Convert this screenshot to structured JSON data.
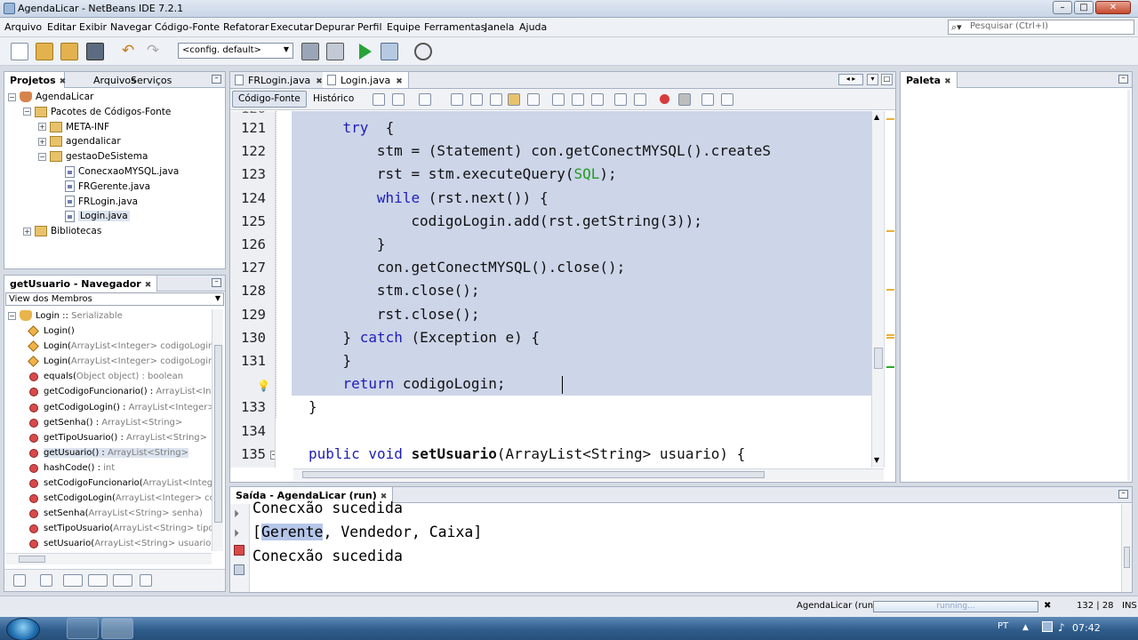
{
  "window": {
    "title": "AgendaLicar - NetBeans IDE 7.2.1",
    "controls": [
      "minimize-button",
      "maximize-button",
      "close-button"
    ]
  },
  "menu": [
    "Arquivo",
    "Editar",
    "Exibir",
    "Navegar",
    "Código-Fonte",
    "Refatorar",
    "Executar",
    "Depurar",
    "Perfil",
    "Equipe",
    "Ferramentas",
    "Janela",
    "Ajuda"
  ],
  "search": {
    "placeholder": "Pesquisar (Ctrl+I)"
  },
  "toolbar": {
    "config": "<config. default>",
    "icons": [
      "new-file-icon",
      "new-project-icon",
      "open-project-icon",
      "save-all-icon",
      "undo-icon",
      "redo-icon",
      "build-icon",
      "clean-build-icon",
      "run-icon",
      "debug-icon",
      "profile-icon"
    ]
  },
  "projects_panel": {
    "tabs": [
      "Projetos",
      "Arquivos",
      "Serviços"
    ],
    "tree": [
      {
        "label": "AgendaLicar",
        "level": 0,
        "icon": "project-icon",
        "expander": "−"
      },
      {
        "label": "Pacotes de Códigos-Fonte",
        "level": 1,
        "icon": "source-packages-icon",
        "expander": "−"
      },
      {
        "label": "META-INF",
        "level": 2,
        "icon": "package-icon",
        "expander": "+"
      },
      {
        "label": "agendalicar",
        "level": 2,
        "icon": "package-icon",
        "expander": "+"
      },
      {
        "label": "gestaoDeSistema",
        "level": 2,
        "icon": "package-icon",
        "expander": "−"
      },
      {
        "label": "ConecxaoMYSQL.java",
        "level": 3,
        "icon": "java-file-icon",
        "expander": ""
      },
      {
        "label": "FRGerente.java",
        "level": 3,
        "icon": "java-file-icon",
        "expander": ""
      },
      {
        "label": "FRLogin.java",
        "level": 3,
        "icon": "java-file-icon",
        "expander": ""
      },
      {
        "label": "Login.java",
        "level": 3,
        "icon": "java-file-icon",
        "expander": "",
        "selected": true
      },
      {
        "label": "Bibliotecas",
        "level": 1,
        "icon": "libraries-icon",
        "expander": "+"
      }
    ]
  },
  "navigator": {
    "title": "getUsuario - Navegador",
    "view": "View dos Membros",
    "root": {
      "name": "Login",
      "sep": " :: ",
      "type": "Serializable"
    },
    "members": [
      {
        "name": "Login()",
        "type": "",
        "kind": "constructor"
      },
      {
        "name": "Login(",
        "type": "ArrayList<Integer> codigoLogin)",
        "kind": "constructor"
      },
      {
        "name": "Login(",
        "type": "ArrayList<Integer> codigoLogin,",
        "kind": "constructor"
      },
      {
        "name": "equals(",
        "type": "Object object) : boolean",
        "kind": "method"
      },
      {
        "name": "getCodigoFuncionario() : ",
        "type": "ArrayList<Int",
        "kind": "method"
      },
      {
        "name": "getCodigoLogin() : ",
        "type": "ArrayList<Integer>",
        "kind": "method"
      },
      {
        "name": "getSenha() : ",
        "type": "ArrayList<String>",
        "kind": "method"
      },
      {
        "name": "getTipoUsuario() : ",
        "type": "ArrayList<String>",
        "kind": "method"
      },
      {
        "name": "getUsuario() : ",
        "type": "ArrayList<String>",
        "kind": "method",
        "selected": true
      },
      {
        "name": "hashCode() : ",
        "type": "int",
        "kind": "method"
      },
      {
        "name": "setCodigoFuncionario(",
        "type": "ArrayList<Intege",
        "kind": "method"
      },
      {
        "name": "setCodigoLogin(",
        "type": "ArrayList<Integer> co",
        "kind": "method"
      },
      {
        "name": "setSenha(",
        "type": "ArrayList<String> senha)",
        "kind": "method"
      },
      {
        "name": "setTipoUsuario(",
        "type": "ArrayList<String> tipoU",
        "kind": "method"
      },
      {
        "name": "setUsuario(",
        "type": "ArrayList<String> usuario)",
        "kind": "method"
      }
    ]
  },
  "editor": {
    "tabs": [
      "FRLogin.java",
      "Login.java"
    ],
    "active_tab": "Login.java",
    "modes": [
      "Código-Fonte",
      "Histórico"
    ],
    "partial_top_line": "120",
    "lines": [
      {
        "n": "121",
        "indent": 12,
        "segs": [
          [
            "kw",
            "try"
          ],
          [
            "",
            "  {"
          ]
        ]
      },
      {
        "n": "122",
        "indent": 16,
        "segs": [
          [
            "",
            "stm = (Statement) con.getConectMYSQL().createS"
          ]
        ]
      },
      {
        "n": "123",
        "indent": 16,
        "segs": [
          [
            "",
            "rst = stm.executeQuery("
          ],
          [
            "fld",
            "SQL"
          ],
          [
            "",
            ");"
          ]
        ]
      },
      {
        "n": "124",
        "indent": 16,
        "segs": [
          [
            "kw",
            "while"
          ],
          [
            "",
            " (rst.next()) {"
          ]
        ]
      },
      {
        "n": "125",
        "indent": 20,
        "segs": [
          [
            "",
            "codigoLogin.add(rst.getString(3));"
          ]
        ]
      },
      {
        "n": "126",
        "indent": 16,
        "segs": [
          [
            "",
            "}"
          ]
        ]
      },
      {
        "n": "127",
        "indent": 16,
        "segs": [
          [
            "",
            "con.getConectMYSQL().close();"
          ]
        ]
      },
      {
        "n": "128",
        "indent": 16,
        "segs": [
          [
            "",
            "stm.close();"
          ]
        ]
      },
      {
        "n": "129",
        "indent": 16,
        "segs": [
          [
            "",
            "rst.close();"
          ]
        ]
      },
      {
        "n": "130",
        "indent": 12,
        "segs": [
          [
            "",
            "} "
          ],
          [
            "kw",
            "catch"
          ],
          [
            "",
            " (Exception e) {"
          ]
        ]
      },
      {
        "n": "131",
        "indent": 12,
        "segs": [
          [
            "",
            "}"
          ]
        ]
      },
      {
        "n": "",
        "indent": 12,
        "segs": [
          [
            "kw",
            "return"
          ],
          [
            "",
            " codigoLogin;"
          ]
        ]
      },
      {
        "n": "133",
        "indent": 8,
        "segs": [
          [
            "",
            "}"
          ]
        ]
      },
      {
        "n": "134",
        "indent": 0,
        "segs": []
      },
      {
        "n": "135",
        "indent": 8,
        "segs": [
          [
            "kw",
            "public"
          ],
          [
            "",
            " "
          ],
          [
            "kw",
            "void"
          ],
          [
            "",
            " "
          ],
          [
            "b",
            "setUsuario"
          ],
          [
            "",
            "(ArrayList<String> usuario) {"
          ]
        ]
      }
    ]
  },
  "palette": {
    "title": "Paleta"
  },
  "output": {
    "title": "Saída - AgendaLicar (run)",
    "lines": [
      "Conecxão sucedida",
      "[Gerente, Vendedor, Caixa]",
      "Conecxão sucedida"
    ],
    "highlight": "Gerente"
  },
  "statusbar": {
    "task": "AgendaLicar (run)",
    "progress_label": "running...",
    "position": "132 | 28",
    "mode": "INS"
  },
  "taskbar": {
    "lang": "PT",
    "time": "07:42"
  }
}
